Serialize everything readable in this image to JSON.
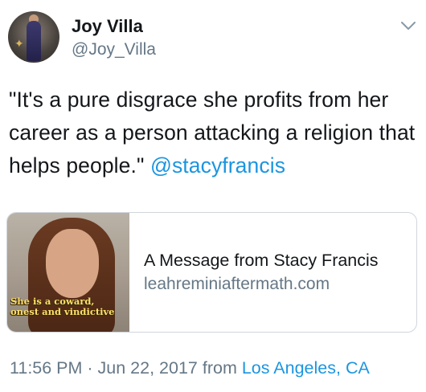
{
  "author": {
    "display_name": "Joy Villa",
    "handle": "@Joy_Villa"
  },
  "tweet": {
    "text": "\"It's a pure disgrace she profits from her career as a person attacking a religion that helps people.\"",
    "mention": "@stacyfrancis"
  },
  "card": {
    "image_caption": "She is a coward,\nonest and vindictive",
    "title": "A Message from Stacy Francis",
    "domain": "leahreminiaftermath.com"
  },
  "meta": {
    "time_date": "11:56 PM · Jun 22, 2017",
    "from_label": "from",
    "location": "Los Angeles, CA"
  },
  "icons": {
    "menu": "chevron-down-icon",
    "avatar_badge": "award-icon"
  },
  "colors": {
    "link": "#1b95e0",
    "secondary_text": "#657786",
    "primary_text": "#14171a"
  }
}
